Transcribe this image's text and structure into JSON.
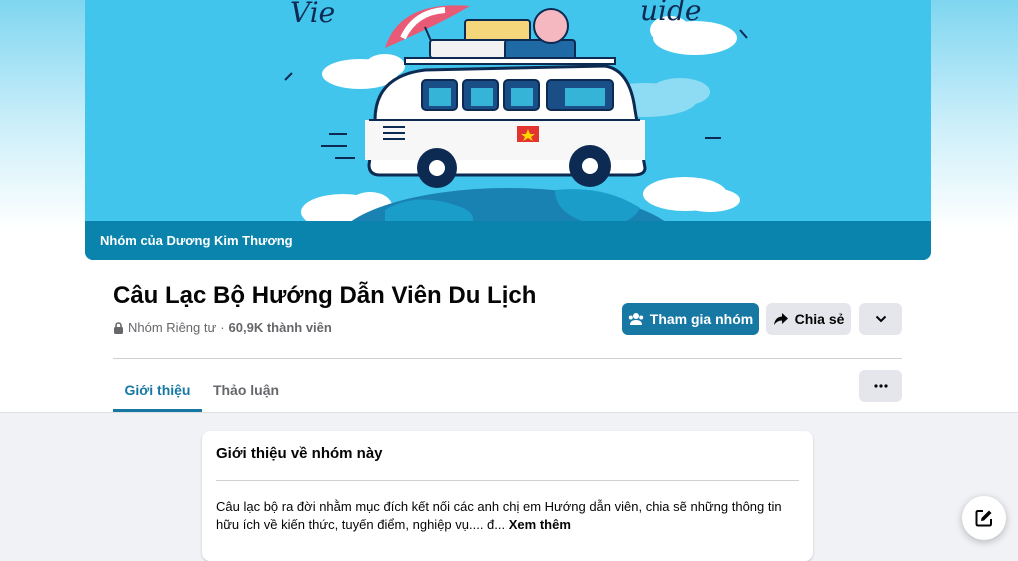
{
  "cover": {
    "caption": "Nhóm của Dương Kim Thương"
  },
  "group": {
    "title": "Câu Lạc Bộ Hướng Dẫn Viên Du Lịch",
    "privacy": "Nhóm Riêng tư",
    "separator": "·",
    "member_count": "60,9K thành viên"
  },
  "actions": {
    "join_label": "Tham gia nhóm",
    "share_label": "Chia sẻ"
  },
  "tabs": [
    {
      "label": "Giới thiệu",
      "active": true
    },
    {
      "label": "Thảo luận",
      "active": false
    }
  ],
  "about_card": {
    "title": "Giới thiệu về nhóm này",
    "description": "Câu lạc bộ ra đời nhằm mục đích kết nối các anh chị em Hướng dẫn viên, chia sẽ những thông tin hữu ích về kiến thức, tuyến điểm, nghiệp vụ.... đ...",
    "see_more": "Xem thêm"
  },
  "colors": {
    "accent": "#1878a4",
    "cover_caption_bg": "#0a84ad",
    "cover_bg": "#42c5ec"
  },
  "icons": [
    "lock-icon",
    "group-icon",
    "share-icon",
    "chevron-down-icon",
    "ellipsis-icon",
    "compose-icon"
  ]
}
